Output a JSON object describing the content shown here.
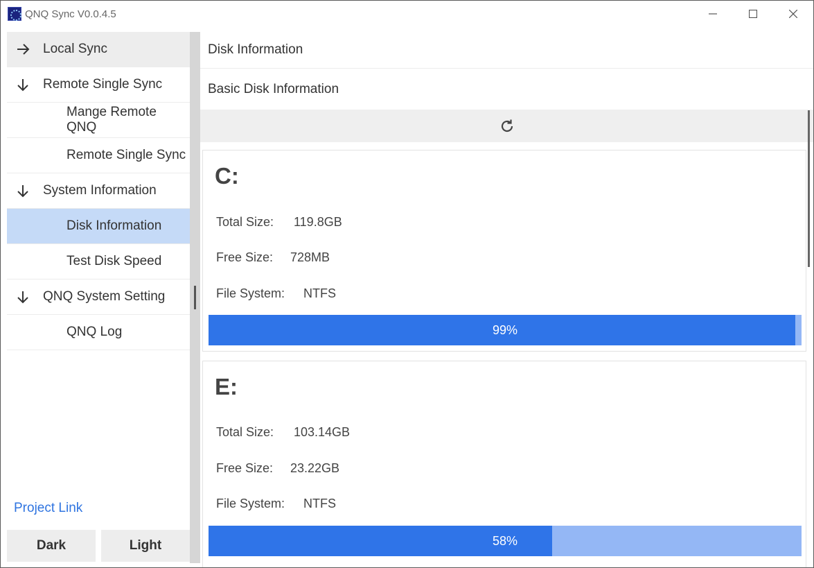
{
  "window": {
    "title": "QNQ Sync V0.0.4.5"
  },
  "sidebar": {
    "items": [
      {
        "label": "Local Sync",
        "level": "top",
        "arrow": "right-arrow-icon"
      },
      {
        "label": "Remote Single Sync",
        "level": "top",
        "arrow": "down-arrow-icon"
      },
      {
        "label": "Mange Remote QNQ",
        "level": "sub"
      },
      {
        "label": "Remote Single Sync",
        "level": "sub"
      },
      {
        "label": "System Information",
        "level": "top",
        "arrow": "down-arrow-icon"
      },
      {
        "label": "Disk Information",
        "level": "sub",
        "selected": true
      },
      {
        "label": "Test Disk Speed",
        "level": "sub"
      },
      {
        "label": "QNQ System Setting",
        "level": "top",
        "arrow": "down-arrow-icon"
      },
      {
        "label": "QNQ Log",
        "level": "sub"
      }
    ],
    "project_link": "Project Link",
    "theme_dark": "Dark",
    "theme_light": "Light"
  },
  "main": {
    "page_title": "Disk Information",
    "section_title": "Basic Disk Information",
    "disks": [
      {
        "name": "C:",
        "total_label": "Total Size:",
        "total_value": "119.8GB",
        "free_label": "Free Size:",
        "free_value": "728MB",
        "fs_label": "File System:",
        "fs_value": "NTFS",
        "usage_text": "99%",
        "usage_fraction": 0.99
      },
      {
        "name": "E:",
        "total_label": "Total Size:",
        "total_value": "103.14GB",
        "free_label": "Free Size:",
        "free_value": "23.22GB",
        "fs_label": "File System:",
        "fs_value": "NTFS",
        "usage_text": "58%",
        "usage_fraction": 0.58
      }
    ]
  },
  "colors": {
    "accent": "#2f74e8",
    "progress_track": "#94b7f5",
    "selected_bg": "#c5daf7",
    "link": "#2f74e0"
  }
}
